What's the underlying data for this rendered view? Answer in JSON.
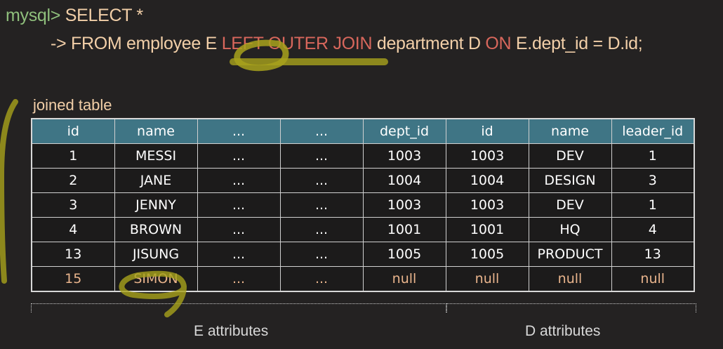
{
  "query": {
    "prompt": "mysql>",
    "line1": " SELECT *",
    "line2_parts": [
      {
        "text": "-> FROM employee E ",
        "kw": false
      },
      {
        "text": "LEFT OUTER JOIN",
        "kw": true
      },
      {
        "text": " department D ",
        "kw": false
      },
      {
        "text": "ON",
        "kw": true
      },
      {
        "text": " E.dept_id = D.id;",
        "kw": false
      }
    ]
  },
  "caption": "joined table",
  "table": {
    "headers": [
      "id",
      "name",
      "...",
      "...",
      "dept_id",
      "id",
      "name",
      "leader_id"
    ],
    "rows": [
      [
        "1",
        "MESSI",
        "...",
        "...",
        "1003",
        "1003",
        "DEV",
        "1"
      ],
      [
        "2",
        "JANE",
        "...",
        "...",
        "1004",
        "1004",
        "DESIGN",
        "3"
      ],
      [
        "3",
        "JENNY",
        "...",
        "...",
        "1003",
        "1003",
        "DEV",
        "1"
      ],
      [
        "4",
        "BROWN",
        "...",
        "...",
        "1001",
        "1001",
        "HQ",
        "4"
      ],
      [
        "13",
        "JISUNG",
        "...",
        "...",
        "1005",
        "1005",
        "PRODUCT",
        "13"
      ],
      [
        "15",
        "SIMON",
        "...",
        "...",
        "null",
        "null",
        "null",
        "null"
      ]
    ],
    "highlighted_row": 5
  },
  "groups": {
    "e": "E attributes",
    "d": "D attributes"
  },
  "colors": {
    "background": "#242222",
    "header": "#3f7585",
    "keyword": "#d8675c",
    "prompt": "#8fbf7c",
    "text": "#f2cfa8",
    "highlight_row": "#e9b48c",
    "annotation": "#a8a21c"
  }
}
